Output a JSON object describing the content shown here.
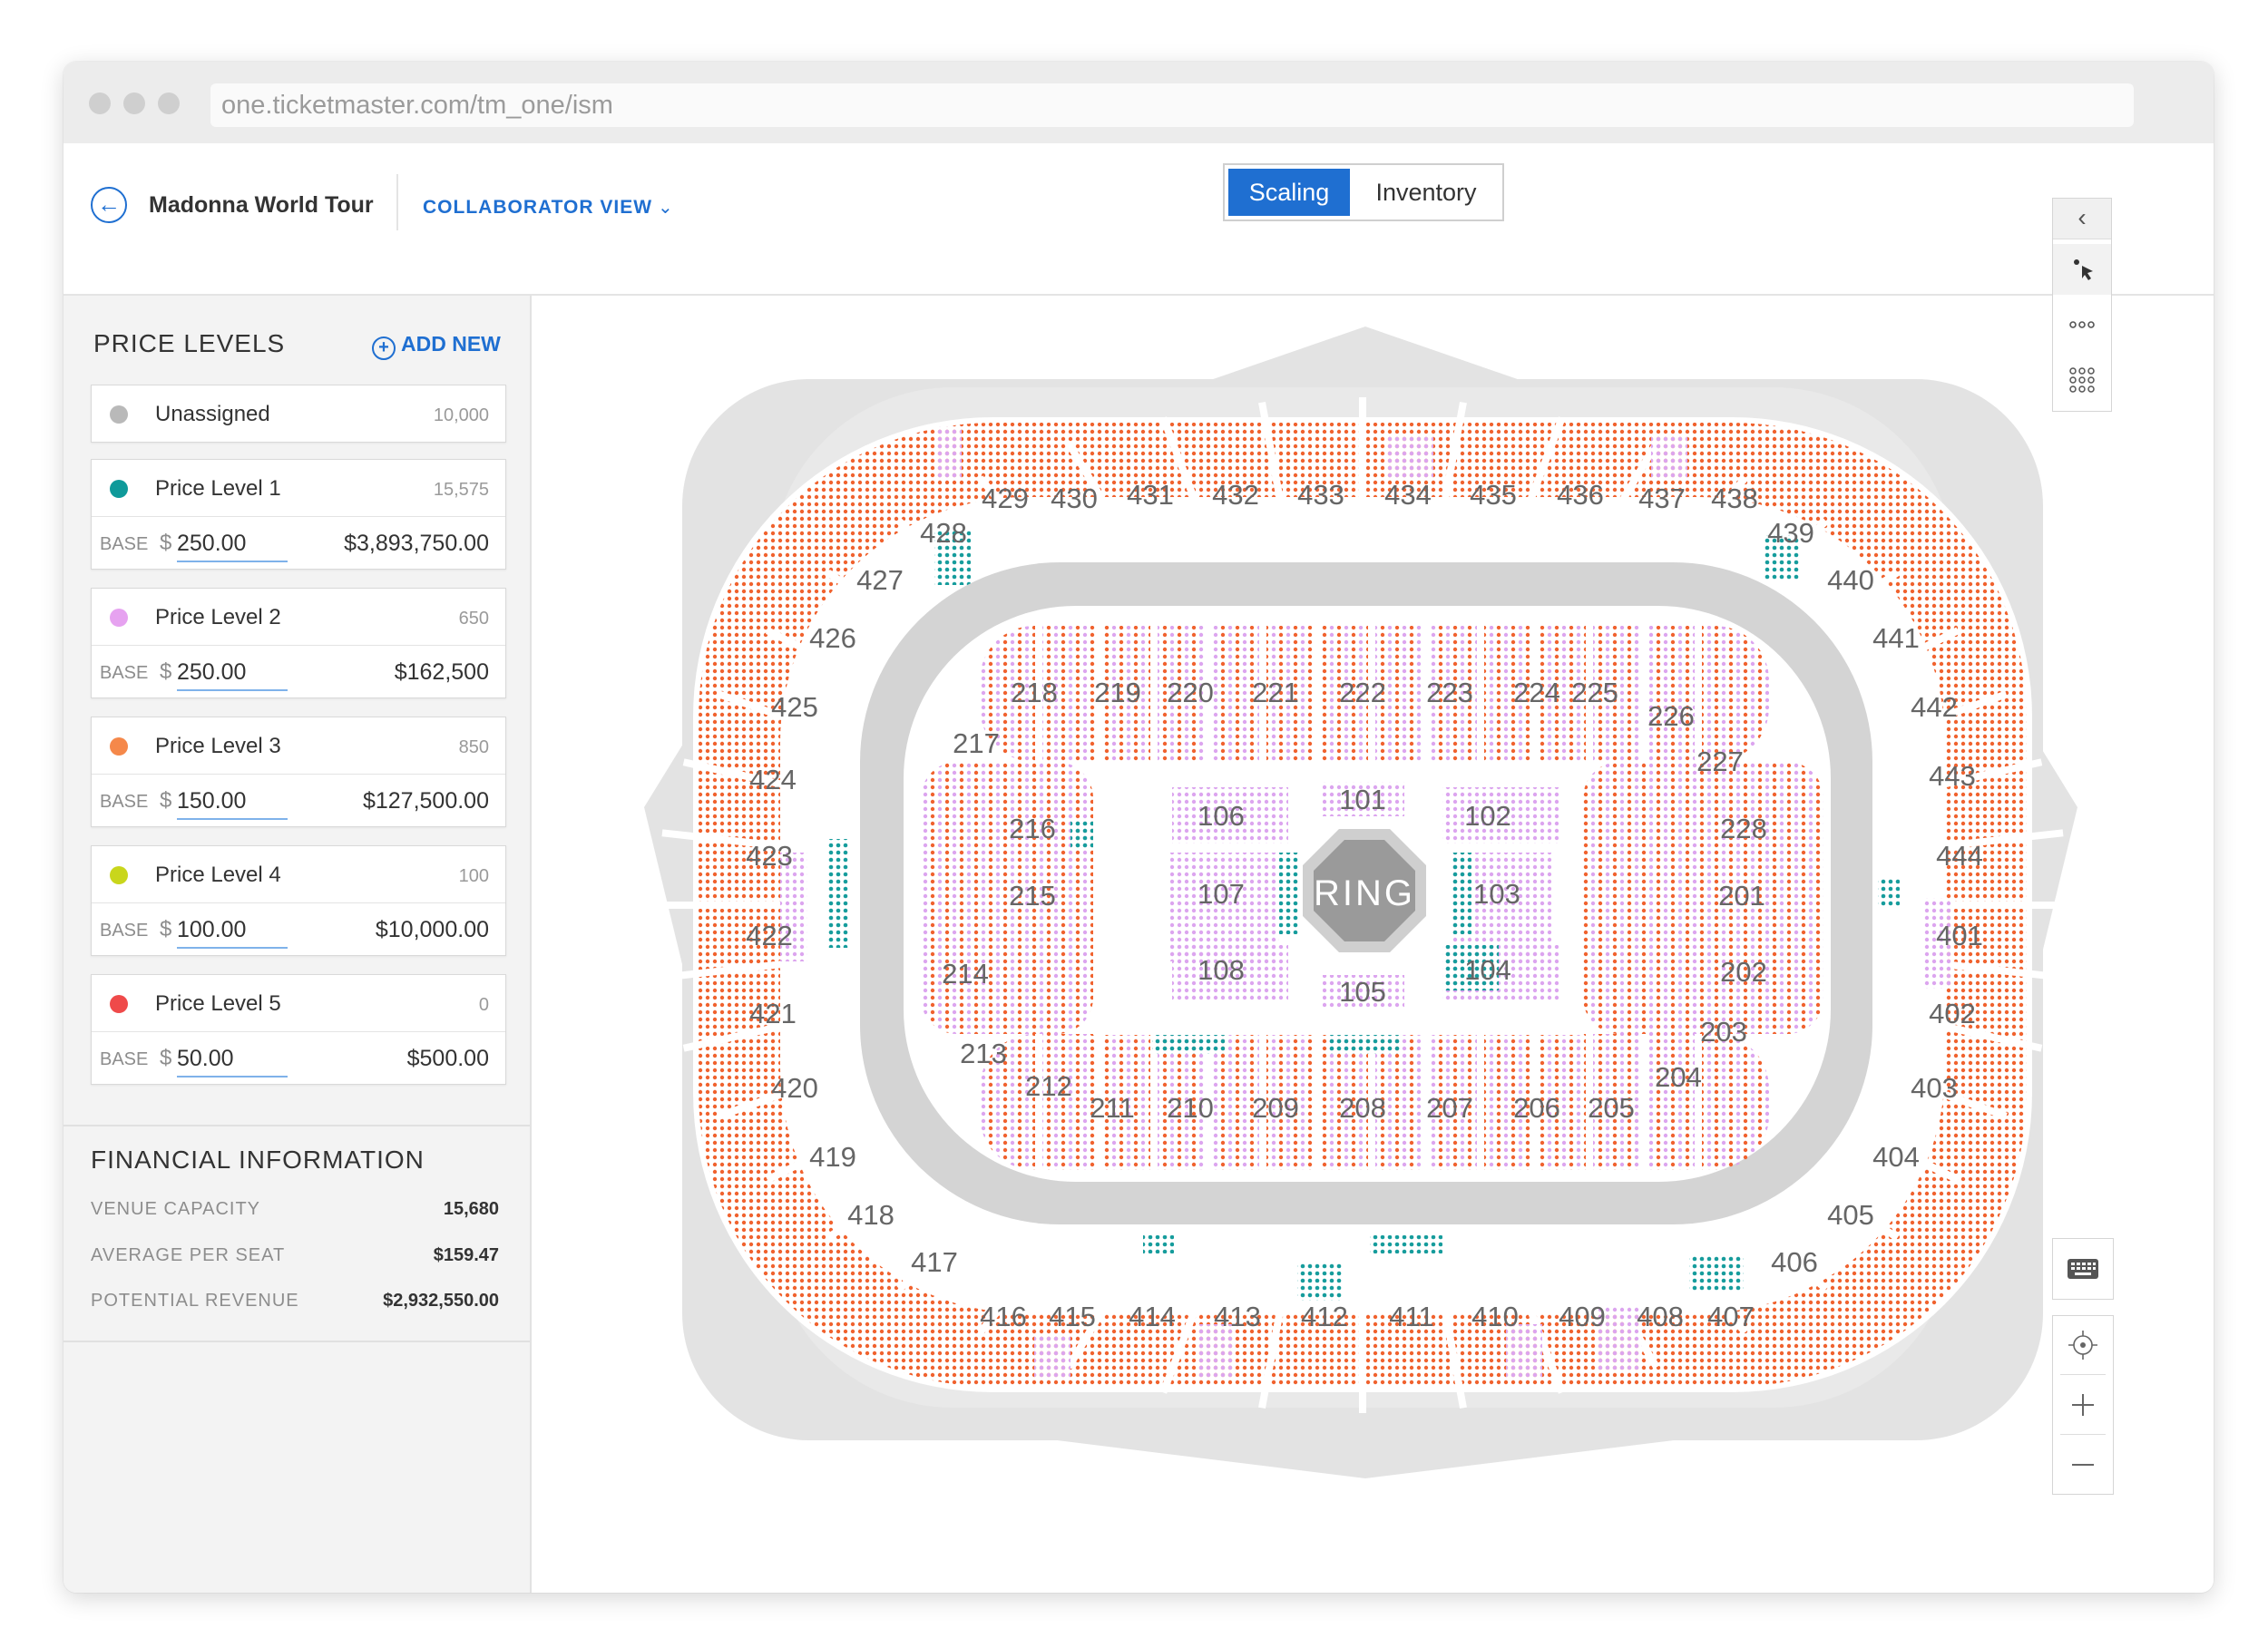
{
  "browser": {
    "url": "one.ticketmaster.com/tm_one/ism"
  },
  "header": {
    "event_title": "Madonna World Tour",
    "view_selector": "COLLABORATOR VIEW",
    "tabs": [
      {
        "label": "Scaling",
        "active": true
      },
      {
        "label": "Inventory",
        "active": false
      }
    ]
  },
  "sidebar": {
    "price_levels_title": "PRICE LEVELS",
    "add_new_label": "ADD NEW",
    "unassigned": {
      "name": "Unassigned",
      "count": "10,000",
      "color": "#b9b9b9"
    },
    "levels": [
      {
        "name": "Price Level 1",
        "count": "15,575",
        "color": "#0f9a9a",
        "base_label": "BASE",
        "currency": "$",
        "base": "250.00",
        "revenue": "$3,893,750.00"
      },
      {
        "name": "Price Level 2",
        "count": "650",
        "color": "#e6a2f0",
        "base_label": "BASE",
        "currency": "$",
        "base": "250.00",
        "revenue": "$162,500"
      },
      {
        "name": "Price Level 3",
        "count": "850",
        "color": "#f5884a",
        "base_label": "BASE",
        "currency": "$",
        "base": "150.00",
        "revenue": "$127,500.00"
      },
      {
        "name": "Price Level 4",
        "count": "100",
        "color": "#c9d61c",
        "base_label": "BASE",
        "currency": "$",
        "base": "100.00",
        "revenue": "$10,000.00"
      },
      {
        "name": "Price Level 5",
        "count": "0",
        "color": "#ef4a4a",
        "base_label": "BASE",
        "currency": "$",
        "base": "50.00",
        "revenue": "$500.00"
      }
    ],
    "financial": {
      "title": "FINANCIAL INFORMATION",
      "rows": [
        {
          "label": "VENUE CAPACITY",
          "value": "15,680"
        },
        {
          "label": "AVERAGE PER SEAT",
          "value": "$159.47"
        },
        {
          "label": "POTENTIAL REVENUE",
          "value": "$2,932,550.00"
        }
      ]
    }
  },
  "map": {
    "center_label": "RING",
    "seat_colors": {
      "orange": "#f0622e",
      "pink": "#dca5ef",
      "teal": "#169c9c",
      "venue_gray": "#e2e2e2",
      "concourse_gray": "#d3d3d3"
    },
    "floor_sections": [
      "101",
      "102",
      "103",
      "104",
      "105",
      "106",
      "107",
      "108"
    ],
    "sections_200_top": [
      "218",
      "219",
      "220",
      "221",
      "222",
      "223",
      "224",
      "225"
    ],
    "sections_200_bottom": [
      "211",
      "210",
      "209",
      "208",
      "207",
      "206",
      "205"
    ],
    "sections_200_left": [
      "217",
      "216",
      "215",
      "214",
      "213",
      "212"
    ],
    "sections_200_right": [
      "226",
      "227",
      "228",
      "201",
      "202",
      "203",
      "204"
    ],
    "sections_400_top": [
      "429",
      "430",
      "431",
      "432",
      "433",
      "434",
      "435",
      "436",
      "437",
      "438"
    ],
    "sections_400_bottom": [
      "416",
      "415",
      "414",
      "413",
      "412",
      "411",
      "410",
      "409",
      "408",
      "407"
    ],
    "sections_400_left": [
      "428",
      "427",
      "426",
      "425",
      "424",
      "423",
      "422",
      "421",
      "420",
      "419",
      "418",
      "417"
    ],
    "sections_400_right": [
      "439",
      "440",
      "441",
      "442",
      "443",
      "444",
      "401",
      "402",
      "403",
      "404",
      "405",
      "406"
    ]
  },
  "map_controls": {
    "collapse_icon": "chevron-left-icon",
    "tools": [
      "pointer-select-icon",
      "row-select-icon",
      "grid-select-icon"
    ],
    "keyboard_icon": "keyboard-icon",
    "zoom": [
      "locate-icon",
      "zoom-in-icon",
      "zoom-out-icon"
    ]
  }
}
